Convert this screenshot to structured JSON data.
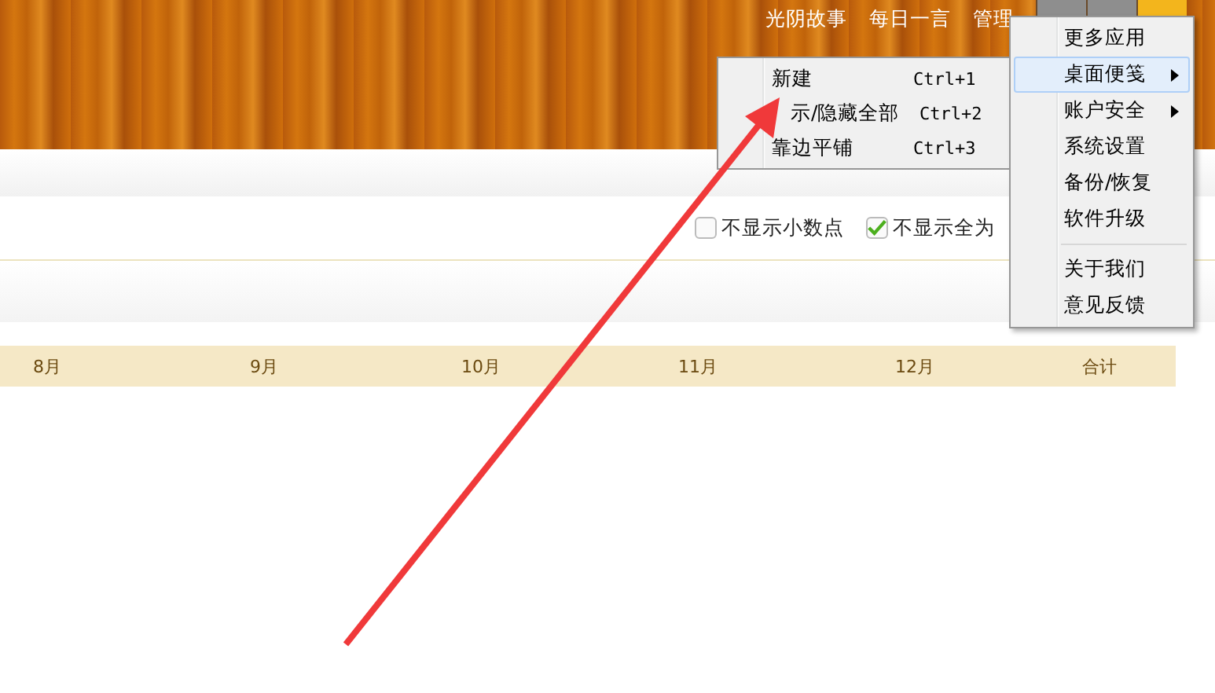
{
  "header": {
    "links": [
      {
        "label": "光阴故事"
      },
      {
        "label": "每日一言"
      },
      {
        "label": "管理"
      }
    ]
  },
  "options": [
    {
      "label": "不显示小数点",
      "checked": false
    },
    {
      "label": "不显示全为",
      "checked": true
    }
  ],
  "table": {
    "columns": [
      "8月",
      "9月",
      "10月",
      "11月",
      "12月",
      "合计"
    ]
  },
  "menu": {
    "items": [
      {
        "kind": "item",
        "label": "更多应用",
        "selected": false,
        "submenu": false
      },
      {
        "kind": "item",
        "label": "桌面便笺",
        "selected": true,
        "submenu": true
      },
      {
        "kind": "item",
        "label": "账户安全",
        "selected": false,
        "submenu": true
      },
      {
        "kind": "item",
        "label": "系统设置",
        "selected": false,
        "submenu": false
      },
      {
        "kind": "item",
        "label": "备份/恢复",
        "selected": false,
        "submenu": false
      },
      {
        "kind": "item",
        "label": "软件升级",
        "selected": false,
        "submenu": false
      },
      {
        "kind": "separator"
      },
      {
        "kind": "item",
        "label": "关于我们",
        "selected": false,
        "submenu": false
      },
      {
        "kind": "item",
        "label": "意见反馈",
        "selected": false,
        "submenu": false
      }
    ]
  },
  "submenu": {
    "items": [
      {
        "label": "新建",
        "shortcut": "Ctrl+1"
      },
      {
        "label": "示/隐藏全部",
        "shortcut": "Ctrl+2"
      },
      {
        "label": "靠边平铺",
        "shortcut": "Ctrl+3"
      }
    ]
  }
}
